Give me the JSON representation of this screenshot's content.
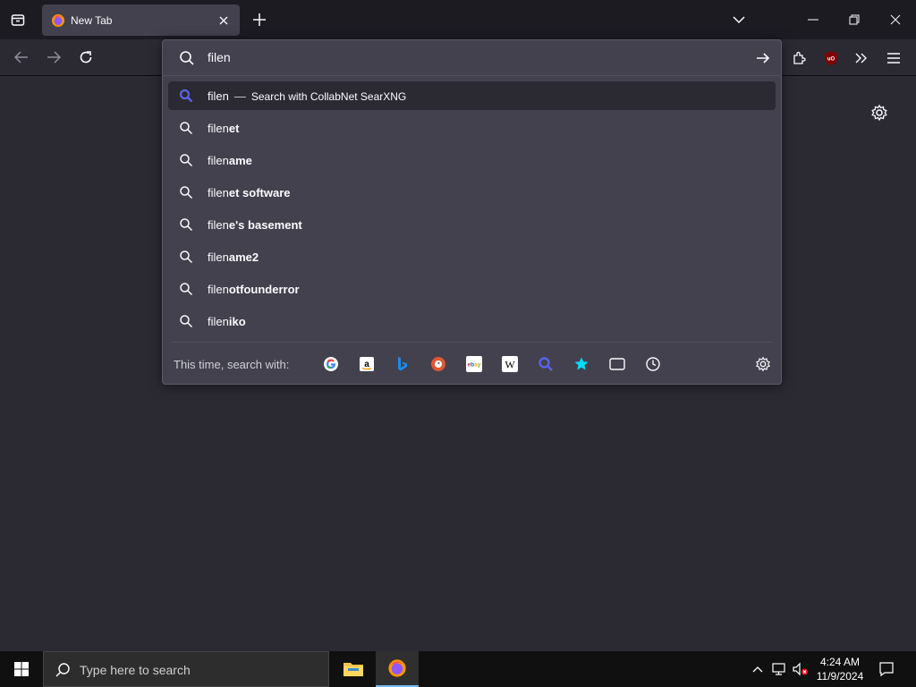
{
  "tab": {
    "title": "New Tab"
  },
  "urlbar": {
    "value": "filen",
    "first_result": {
      "typed": "filen",
      "separator": "—",
      "action": "Search with CollabNet SearXNG"
    },
    "suggestions": [
      {
        "prefix": "filen",
        "suffix": "et"
      },
      {
        "prefix": "filen",
        "suffix": "ame"
      },
      {
        "prefix": "filen",
        "suffix": "et software"
      },
      {
        "prefix": "filen",
        "suffix": "e's basement"
      },
      {
        "prefix": "filen",
        "suffix": "ame2"
      },
      {
        "prefix": "filen",
        "suffix": "otfounderror"
      },
      {
        "prefix": "filen",
        "suffix": "iko"
      }
    ],
    "oneoff_label": "This time, search with:",
    "engines": [
      "google-icon",
      "amazon-icon",
      "bing-icon",
      "duckduckgo-icon",
      "ebay-icon",
      "wikipedia-icon",
      "searxng-icon",
      "bookmarks-icon",
      "tabs-icon",
      "history-icon"
    ]
  },
  "taskbar": {
    "search_placeholder": "Type here to search",
    "time": "4:24 AM",
    "date": "11/9/2024"
  },
  "colors": {
    "accent": "#5a63e8",
    "taskbar_active": "#76b9ed"
  }
}
